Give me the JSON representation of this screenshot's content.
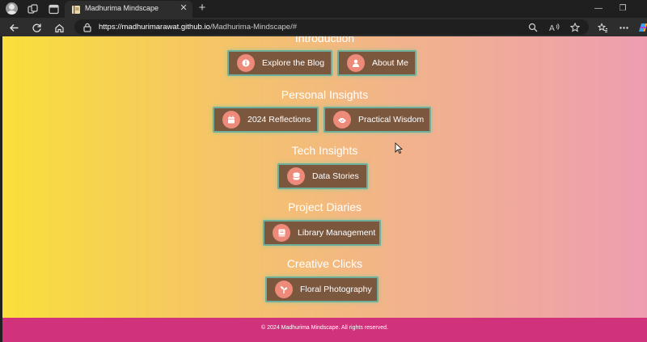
{
  "browser": {
    "tab_title": "Madhurima Mindscape",
    "url_host": "https://madhurimarawat.github.io",
    "url_path": "/Madhurima-Mindscape/#",
    "colors": {
      "chrome_dark": "#1f1f1f",
      "chrome_mid": "#2d2d2d"
    },
    "icons": [
      "avatar",
      "workspaces-icon",
      "tab-actions-icon",
      "book-favicon",
      "close-icon",
      "plus-icon",
      "minimize-icon",
      "restore-icon",
      "back-icon",
      "refresh-icon",
      "home-icon",
      "lock-icon",
      "zoom-icon",
      "read-aloud-icon",
      "favorite-star-icon",
      "favorites-icon",
      "more-icon",
      "copilot-icon"
    ]
  },
  "page": {
    "sections": [
      {
        "title": "Introduction",
        "buttons": [
          {
            "label": "Explore the Blog",
            "icon": "info-icon"
          },
          {
            "label": "About Me",
            "icon": "user-icon"
          }
        ]
      },
      {
        "title": "Personal Insights",
        "buttons": [
          {
            "label": "2024 Reflections",
            "icon": "calendar-icon"
          },
          {
            "label": "Practical Wisdom",
            "icon": "handshake-icon"
          }
        ]
      },
      {
        "title": "Tech Insights",
        "buttons": [
          {
            "label": "Data Stories",
            "icon": "database-icon"
          }
        ]
      },
      {
        "title": "Project Diaries",
        "buttons": [
          {
            "label": "Library Management",
            "icon": "book-icon"
          }
        ]
      },
      {
        "title": "Creative Clicks",
        "buttons": [
          {
            "label": "Floral Photography",
            "icon": "seedling-icon"
          }
        ]
      }
    ],
    "footer": "© 2024 Madhurima Mindscape. All rights reserved.",
    "colors": {
      "gradient_start": "#f9df3b",
      "gradient_end": "#ee9db0",
      "button_bg": "#7b573e",
      "button_border": "#6fae9b",
      "icon_circle": "#ee8a7a",
      "footer_bg": "#d0327b"
    }
  }
}
